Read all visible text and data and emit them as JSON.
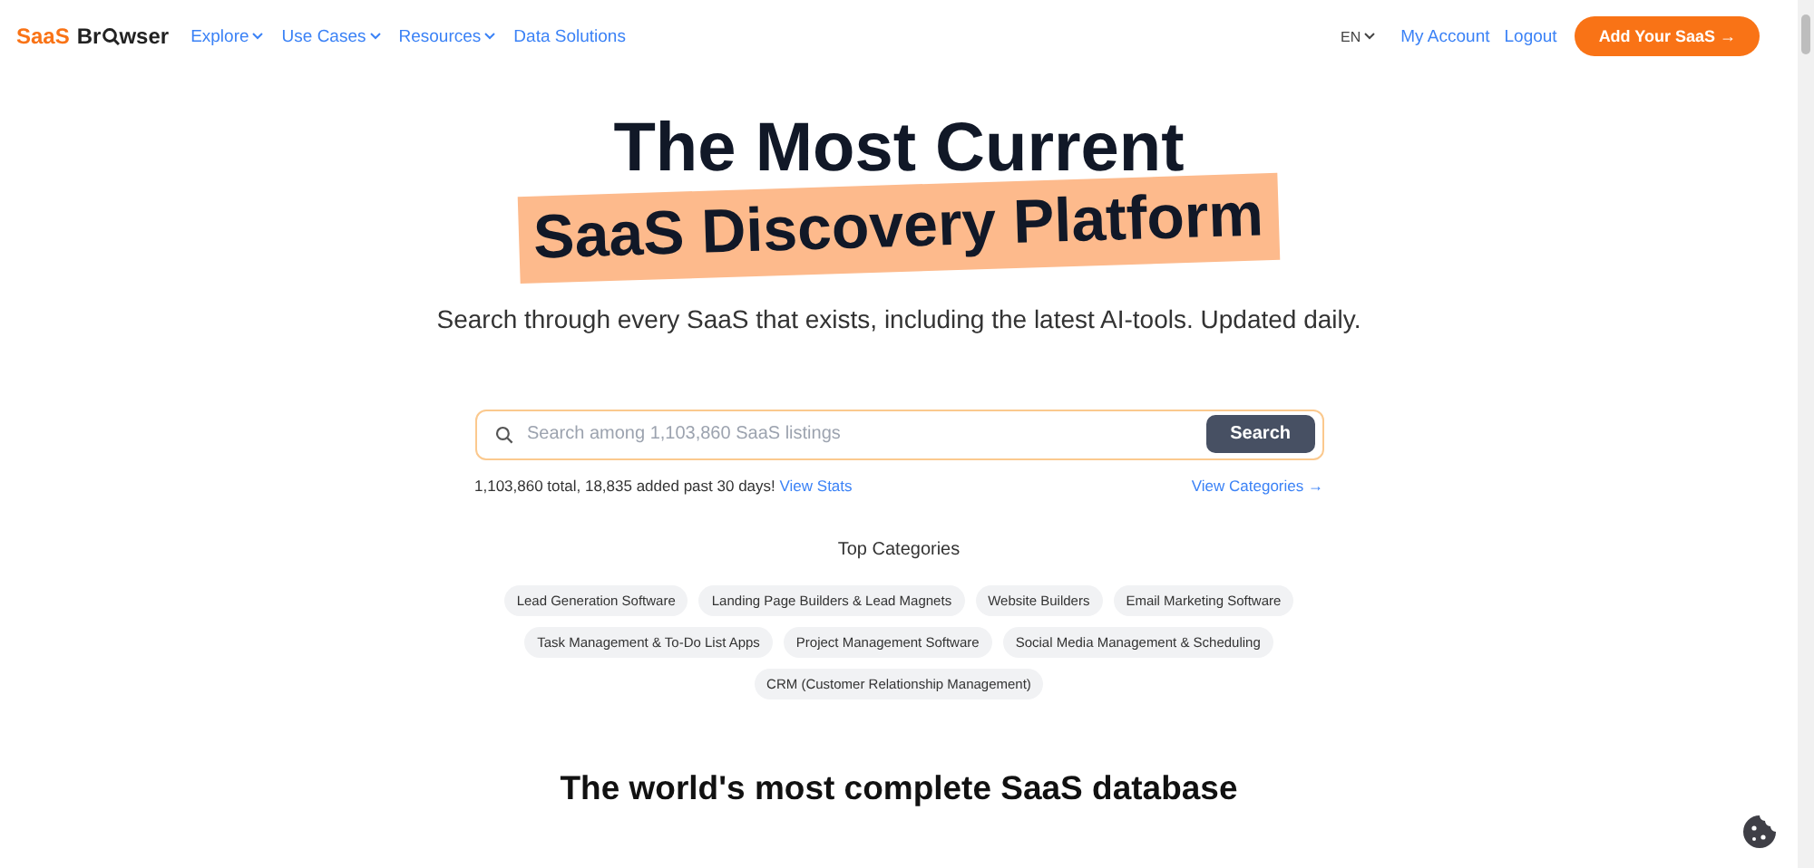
{
  "header": {
    "logo": {
      "accent": "SaaS",
      "name_start": "Br",
      "name_end": "wser"
    },
    "nav": [
      {
        "label": "Explore",
        "kind": "dropdown"
      },
      {
        "label": "Use Cases",
        "kind": "dropdown"
      },
      {
        "label": "Resources",
        "kind": "dropdown"
      },
      {
        "label": "Data Solutions",
        "kind": "link"
      }
    ],
    "language": "EN",
    "account_links": [
      "My Account",
      "Logout"
    ],
    "cta": "Add Your SaaS →"
  },
  "hero": {
    "title": "The Most Current",
    "highlight": "SaaS Discovery Platform",
    "subtitle": "Search through every SaaS that exists, including the latest AI-tools. Updated daily."
  },
  "search": {
    "placeholder": "Search among 1,103,860 SaaS listings",
    "button": "Search",
    "stats": "1,103,860 total, 18,835 added past 30 days!",
    "stats_link": "View Stats",
    "categories_link": "View Categories →"
  },
  "top_categories": {
    "title": "Top Categories",
    "items": [
      "Lead Generation Software",
      "Landing Page Builders & Lead Magnets",
      "Website Builders",
      "Email Marketing Software",
      "Task Management & To-Do List Apps",
      "Project Management Software",
      "Social Media Management & Scheduling",
      "CRM (Customer Relationship Management)"
    ]
  },
  "section_heading": "The world's most complete SaaS database"
}
